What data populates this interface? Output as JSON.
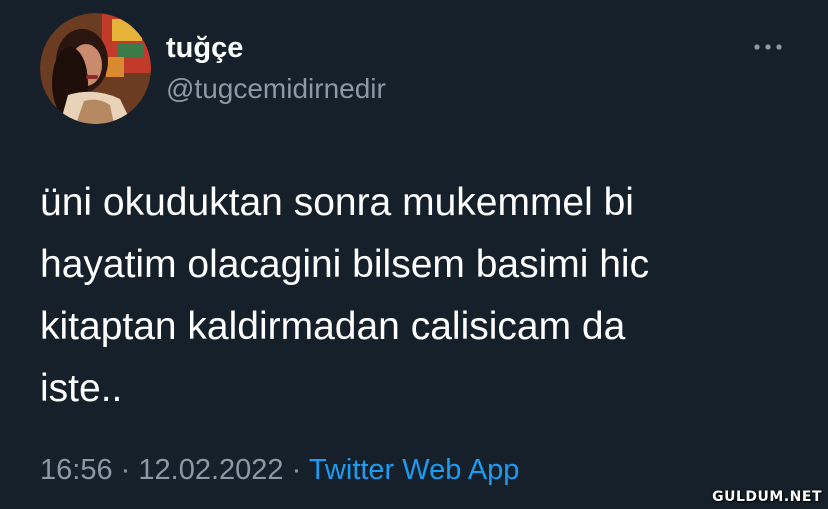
{
  "author": {
    "display_name": "tuğçe",
    "handle": "@tugcemidirnedir",
    "avatar_icon": "profile-photo"
  },
  "more_icon": "more-horizontal-icon",
  "tweet": {
    "text": "üni okuduktan sonra mukemmel bi\nhayatim olacagini bilsem basimi hic\nkitaptan kaldirmadan calisicam da\niste.."
  },
  "meta": {
    "time": "16:56",
    "separator": "·",
    "date": "12.02.2022",
    "source": "Twitter Web App"
  },
  "watermark": "GULDUM.NET",
  "colors": {
    "background": "#15202b",
    "primary_text": "#ffffff",
    "secondary_text": "#8b98a5",
    "link": "#1d9bf0"
  }
}
